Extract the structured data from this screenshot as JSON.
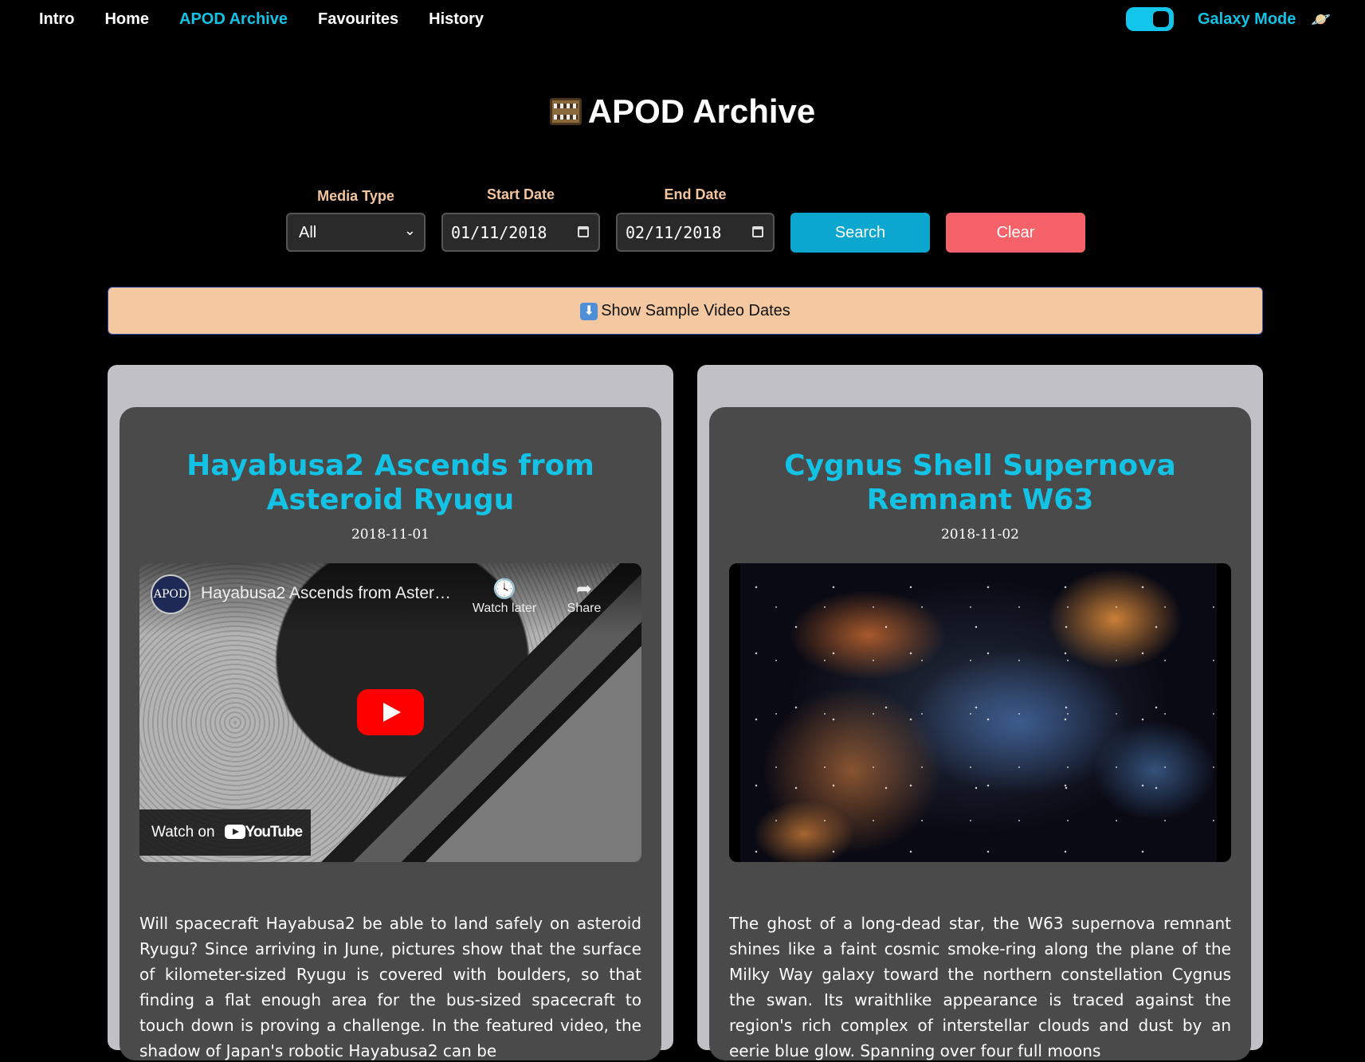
{
  "nav": {
    "links": [
      "Intro",
      "Home",
      "APOD Archive",
      "Favourites",
      "History"
    ],
    "active": "APOD Archive",
    "galaxy_mode_label": "Galaxy Mode",
    "galaxy_icon": "saturn-icon"
  },
  "page": {
    "title": "APOD Archive",
    "title_icon": "film-frames-icon"
  },
  "filters": {
    "media_type_label": "Media Type",
    "media_type_value": "All",
    "start_date_label": "Start Date",
    "start_date_value": "01/11/2018",
    "end_date_label": "End Date",
    "end_date_value": "02/11/2018",
    "search_label": "Search",
    "clear_label": "Clear"
  },
  "sample_bar": {
    "label": "Show Sample Video Dates",
    "icon": "down-arrow-icon"
  },
  "cards": [
    {
      "title": "Hayabusa2 Ascends from Asteroid Ryugu",
      "date": "2018-11-01",
      "media": "video",
      "video_title": "Hayabusa2 Ascends from Aster…",
      "channel_logo_text": "APOD",
      "watch_later_label": "Watch later",
      "share_label": "Share",
      "watch_on_label": "Watch on",
      "youtube_label": "YouTube",
      "text": "Will spacecraft Hayabusa2 be able to land safely on asteroid Ryugu? Since arriving in June, pictures show that the surface of kilometer-sized Ryugu is covered with boulders, so that finding a flat enough area for the bus-sized spacecraft to touch down is proving a challenge. In the featured video, the shadow of Japan's robotic Hayabusa2 can be"
    },
    {
      "title": "Cygnus Shell Supernova Remnant W63",
      "date": "2018-11-02",
      "media": "image",
      "text": "The ghost of a long-dead star, the W63 supernova remnant shines like a faint cosmic smoke-ring along the plane of the Milky Way galaxy toward the northern constellation Cygnus the swan. Its wraithlike appearance is traced against the region's rich complex of interstellar clouds and dust by an eerie blue glow. Spanning over four full moons"
    }
  ],
  "colors": {
    "accent": "#13c3e6",
    "search_button": "#0ba7cf",
    "clear_button": "#f5626a",
    "label": "#f4c59e",
    "sample_bar": "#f4c8a0"
  }
}
